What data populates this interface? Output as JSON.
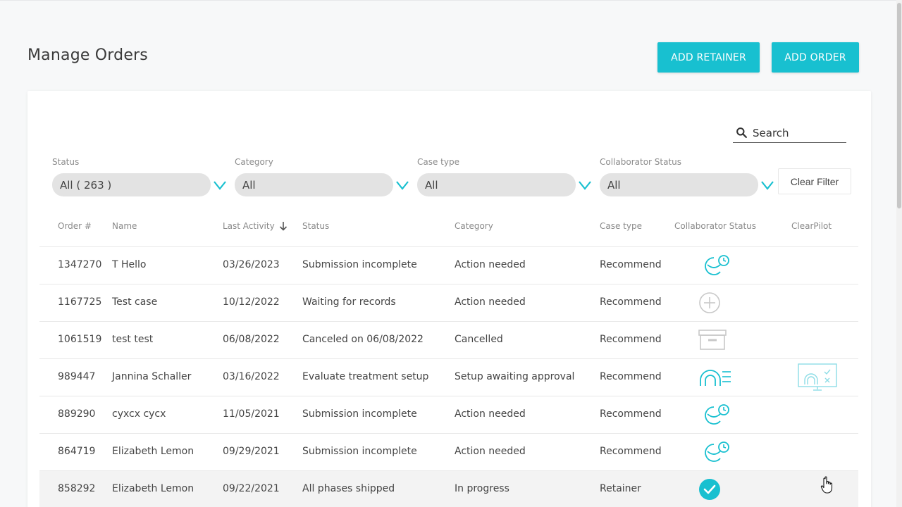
{
  "page": {
    "title": "Manage Orders"
  },
  "actions": {
    "add_retainer": "ADD RETAINER",
    "add_order": "ADD ORDER"
  },
  "search": {
    "label": "Search"
  },
  "filters": [
    {
      "label": "Status",
      "value": "All ( 263 )"
    },
    {
      "label": "Category",
      "value": "All"
    },
    {
      "label": "Case type",
      "value": "All"
    },
    {
      "label": "Collaborator Status",
      "value": "All"
    }
  ],
  "clear_filter": "Clear Filter",
  "table": {
    "columns": [
      "Order #",
      "Name",
      "Last Activity",
      "Status",
      "Category",
      "Case type",
      "Collaborator Status",
      "ClearPilot"
    ],
    "rows": [
      {
        "order": "1347270",
        "name": "T Hello",
        "last_activity": "03/26/2023",
        "status": "Submission incomplete",
        "category": "Action needed",
        "case_type": "Recommend",
        "collab_icon": "aligner-clock-icon",
        "clearpilot": ""
      },
      {
        "order": "1167725",
        "name": "Test case",
        "last_activity": "10/12/2022",
        "status": "Waiting for records",
        "category": "Action needed",
        "case_type": "Recommend",
        "collab_icon": "plus-circle-icon",
        "clearpilot": ""
      },
      {
        "order": "1061519",
        "name": "test test",
        "last_activity": "06/08/2022",
        "status": "Canceled on 06/08/2022",
        "category": "Cancelled",
        "case_type": "Recommend",
        "collab_icon": "archive-box-icon",
        "clearpilot": ""
      },
      {
        "order": "989447",
        "name": "Jannina Schaller",
        "last_activity": "03/16/2022",
        "status": "Evaluate treatment setup",
        "category": "Setup awaiting approval",
        "case_type": "Recommend",
        "collab_icon": "arch-list-icon",
        "clearpilot": "clearpilot-monitor-icon"
      },
      {
        "order": "889290",
        "name": "cyxcx cycx",
        "last_activity": "11/05/2021",
        "status": "Submission incomplete",
        "category": "Action needed",
        "case_type": "Recommend",
        "collab_icon": "aligner-clock-icon",
        "clearpilot": ""
      },
      {
        "order": "864719",
        "name": "Elizabeth Lemon",
        "last_activity": "09/29/2021",
        "status": "Submission incomplete",
        "category": "Action needed",
        "case_type": "Recommend",
        "collab_icon": "aligner-clock-icon",
        "clearpilot": ""
      },
      {
        "order": "858292",
        "name": "Elizabeth Lemon",
        "last_activity": "09/22/2021",
        "status": "All phases shipped",
        "category": "In progress",
        "case_type": "Retainer",
        "collab_icon": "check-circle-icon",
        "clearpilot": ""
      }
    ]
  },
  "colors": {
    "accent": "#18c0d0",
    "filter_bg": "#e3e3e3",
    "row_hover": "#f3f3f3"
  }
}
